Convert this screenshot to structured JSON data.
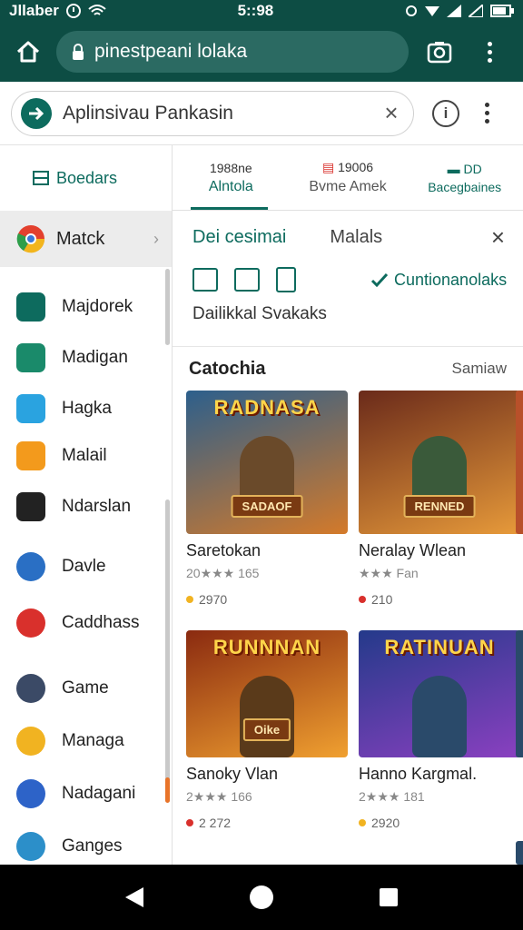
{
  "status": {
    "carrier": "Jllaber",
    "time": "5::98"
  },
  "browser": {
    "url": "pinestpeani lolaka"
  },
  "search": {
    "query": "Aplinsivau Pankasin",
    "clear": "×",
    "info": "i"
  },
  "sidebar": {
    "header": "Boedars",
    "active": "Matck",
    "items": [
      {
        "label": "Majdorek",
        "icon": "chart-icon",
        "color": "#0d6b5e"
      },
      {
        "label": "Madigan",
        "icon": "refresh-icon",
        "color": "#1a8a6a"
      },
      {
        "label": "Hagka",
        "icon": "twitter-icon",
        "color": "#2aa3e0"
      },
      {
        "label": "Malail",
        "icon": "mail-icon",
        "color": "#f39a1c"
      },
      {
        "label": "Ndarslan",
        "icon": "plus-icon",
        "color": "#222222"
      },
      {
        "label": "Davle",
        "icon": "game-badge-icon",
        "color": "#2a6fc4"
      },
      {
        "label": "Caddhass",
        "icon": "play-icon",
        "color": "#d9302c"
      },
      {
        "label": "Game",
        "icon": "avatar-icon",
        "color": "#3b4a66"
      },
      {
        "label": "Managa",
        "icon": "sun-icon",
        "color": "#f1b321"
      },
      {
        "label": "Nadagani",
        "icon": "h5-icon",
        "color": "#2d63c8"
      },
      {
        "label": "Ganges",
        "icon": "game-icon",
        "color": "#2c8fc9"
      }
    ]
  },
  "tabs": [
    {
      "top": "1988ne",
      "label": "Alntola"
    },
    {
      "top": "19006",
      "label": "Bvme Amek"
    },
    {
      "top": "DD",
      "label": "Bacegbaines"
    }
  ],
  "panel": {
    "title": "Dei cesimai",
    "alt": "Malals",
    "close": "×",
    "link": "Cuntionanolaks",
    "subtitle": "Dailikkal Svakaks"
  },
  "catalog": {
    "title": "Catochia",
    "more": "Samiaw",
    "cards": [
      {
        "banner": "RADNASA",
        "badge": "SADAOF",
        "title": "Saretokan",
        "rating": "20★★★ 165",
        "meta": "2970",
        "dot": "#f1b321",
        "bg1": "#2c5f8c",
        "bg2": "#d47a2a",
        "hero": "#6a4a2a"
      },
      {
        "banner": "",
        "badge": "RENNED",
        "title": "Neralay Wlean",
        "rating": "★★★ Fan",
        "meta": "210",
        "dot": "#d9302c",
        "bg1": "#6a2a1a",
        "bg2": "#e79a3a",
        "hero": "#3a5a3a"
      },
      {
        "banner": "RUNNNAN",
        "badge": "Oike",
        "title": "Sanoky Vlan",
        "rating": "2★★★ 166",
        "meta": "2 272",
        "dot": "#d9302c",
        "bg1": "#8a2a10",
        "bg2": "#f0a030",
        "hero": "#5a3a1a"
      },
      {
        "banner": "RATINUAN",
        "badge": "",
        "title": "Hanno Kargmal.",
        "rating": "2★★★ 181",
        "meta": "2920",
        "dot": "#f1b321",
        "bg1": "#243a8a",
        "bg2": "#8a40c0",
        "hero": "#2a4a6a"
      }
    ]
  },
  "colors": {
    "primary": "#0d4d44",
    "accent": "#0d6b5e"
  }
}
